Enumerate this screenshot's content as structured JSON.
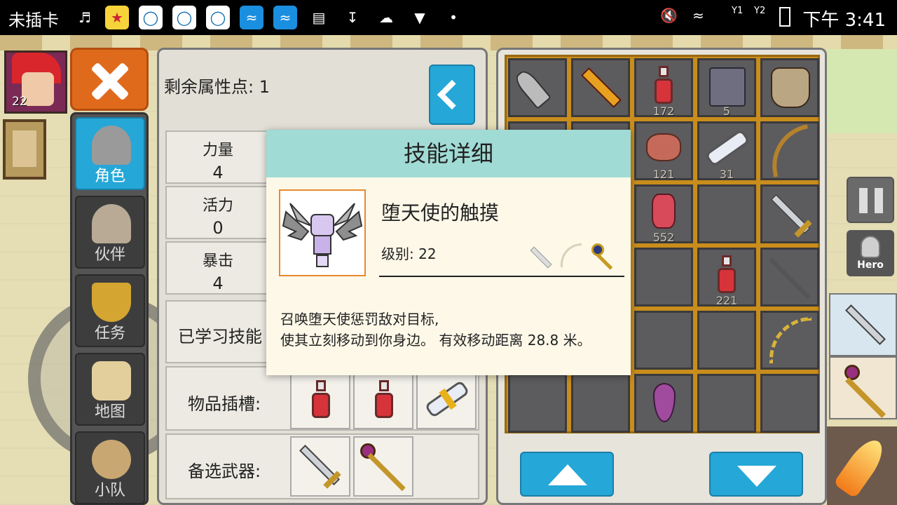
{
  "status_bar": {
    "carrier": "未插卡",
    "time": "下午 3:41",
    "sim1": "Y1",
    "sim2": "Y2",
    "left_icons": [
      "headset-icon",
      "star-app-icon",
      "qq-icon",
      "qq-icon",
      "qq-icon",
      "wifi-hotspot-icon",
      "wifi-hotspot-icon",
      "gallery-icon",
      "download-icon",
      "weather-icon",
      "shield-icon",
      "hotspot-icon"
    ],
    "right_icons": [
      "mute-icon",
      "wifi-icon",
      "signal-icon",
      "battery-icon"
    ]
  },
  "player": {
    "level": "22"
  },
  "menu": {
    "items": [
      {
        "label": "角色",
        "icon": "helmet-icon",
        "active": true
      },
      {
        "label": "伙伴",
        "icon": "horned-helmet-icon",
        "active": false
      },
      {
        "label": "任务",
        "icon": "trophy-icon",
        "active": false
      },
      {
        "label": "地图",
        "icon": "map-icon",
        "active": false
      },
      {
        "label": "小队",
        "icon": "party-icon",
        "active": false
      }
    ]
  },
  "character": {
    "attr_points_label": "剩余属性点: 1",
    "stats": [
      {
        "name": "力量",
        "value": "4"
      },
      {
        "name": "活力",
        "value": "0"
      },
      {
        "name": "暴击",
        "value": "4"
      }
    ],
    "learned_skills_label": "已学习技能",
    "item_slots_label": "物品插槽:",
    "alt_weapons_label": "备选武器:"
  },
  "inventory": {
    "counts": {
      "r0c2": "172",
      "r0c3": "5",
      "r1c2": "121",
      "r1c3": "31",
      "r2c2": "552",
      "r3c3": "221"
    }
  },
  "hud": {
    "hero_label": "Hero"
  },
  "modal": {
    "title": "技能详细",
    "skill_name": "堕天使的触摸",
    "level_label": "级别: 22",
    "description_line1": "召唤堕天使惩罚敌对目标,",
    "description_line2": "使其立刻移动到你身边。 有效移动距离 28.8 米。"
  },
  "colors": {
    "accent_blue": "#25a7d8",
    "close_orange": "#e06a1c",
    "modal_header": "#a1dbd5",
    "inventory_frame": "#c88d1c"
  }
}
